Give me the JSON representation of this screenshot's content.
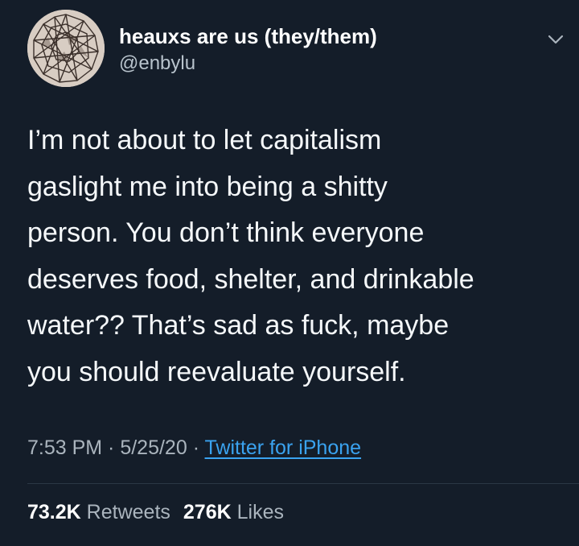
{
  "author": {
    "display_name": "heauxs are us (they/them)",
    "handle": "@enbylu",
    "avatar_icon": "avatar-image"
  },
  "tweet": {
    "text": "I’m not about to let capitalism\ngaslight me into being a shitty\nperson. You don’t think everyone\ndeserves food, shelter, and drinkable\nwater?? That’s sad as fuck, maybe\nyou should reevaluate yourself.",
    "time": "7:53 PM",
    "date": "5/25/20",
    "source": "Twitter for iPhone",
    "separator": " · "
  },
  "stats": {
    "retweets_count": "73.2K",
    "retweets_label": "Retweets",
    "likes_count": "276K",
    "likes_label": "Likes"
  },
  "colors": {
    "background": "#141d29",
    "link": "#3aa3f0",
    "secondary_text": "#aab4bd"
  },
  "icons": {
    "menu": "chevron-down-icon"
  }
}
